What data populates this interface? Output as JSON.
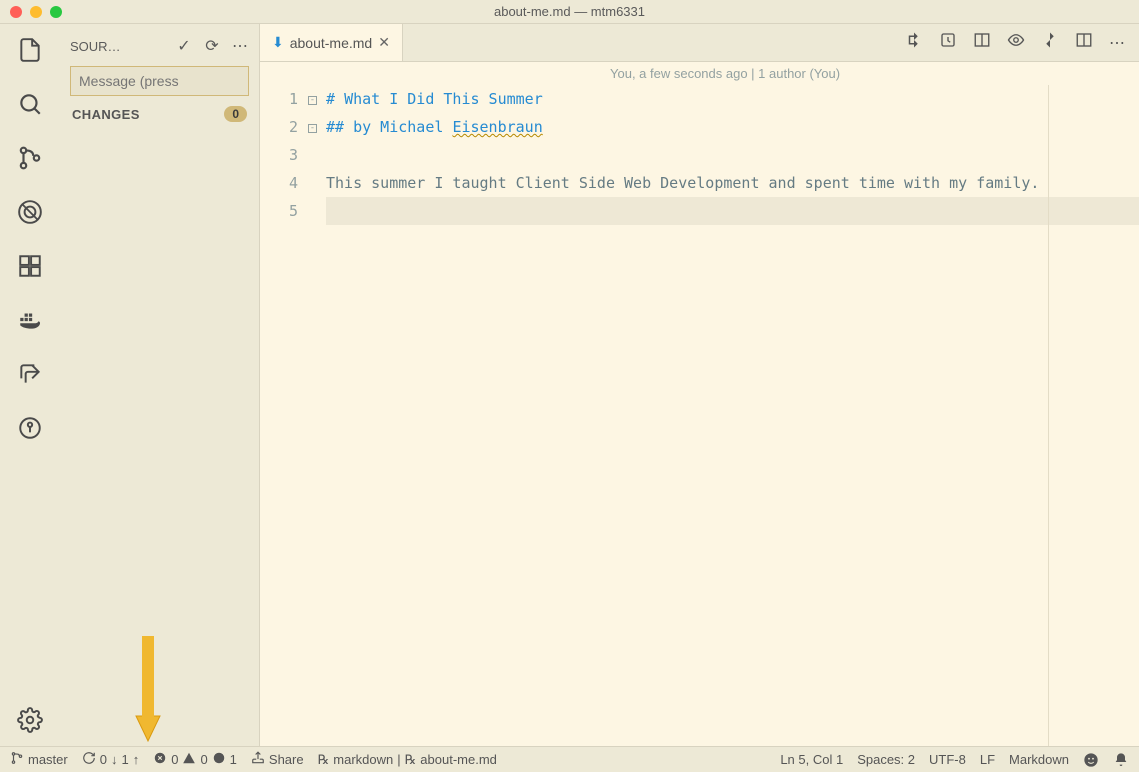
{
  "title_bar": {
    "title": "about-me.md — mtm6331"
  },
  "sidebar": {
    "panel_title": "SOUR…",
    "message_placeholder": "Message (press",
    "changes_label": "CHANGES",
    "changes_count": "0"
  },
  "tab": {
    "label": "about-me.md"
  },
  "gitlens_info": "You, a few seconds ago | 1 author (You)",
  "lines": {
    "l1_hash": "# ",
    "l1_text": "What I Did This Summer",
    "l2_hash": "## ",
    "l2_by": "by Michael ",
    "l2_name": "Eisenbraun",
    "l4": "This summer I taught Client Side Web Development and spent time with my family."
  },
  "line_numbers": [
    "1",
    "2",
    "3",
    "4",
    "5"
  ],
  "status": {
    "branch": "master",
    "sync_down": "0",
    "sync_up": "1",
    "errors": "0",
    "warnings": "0",
    "info": "1",
    "share": "Share",
    "lang_scope": "markdown",
    "file": "about-me.md",
    "position": "Ln 5, Col 1",
    "spaces": "Spaces: 2",
    "encoding": "UTF-8",
    "eol": "LF",
    "language": "Markdown"
  }
}
